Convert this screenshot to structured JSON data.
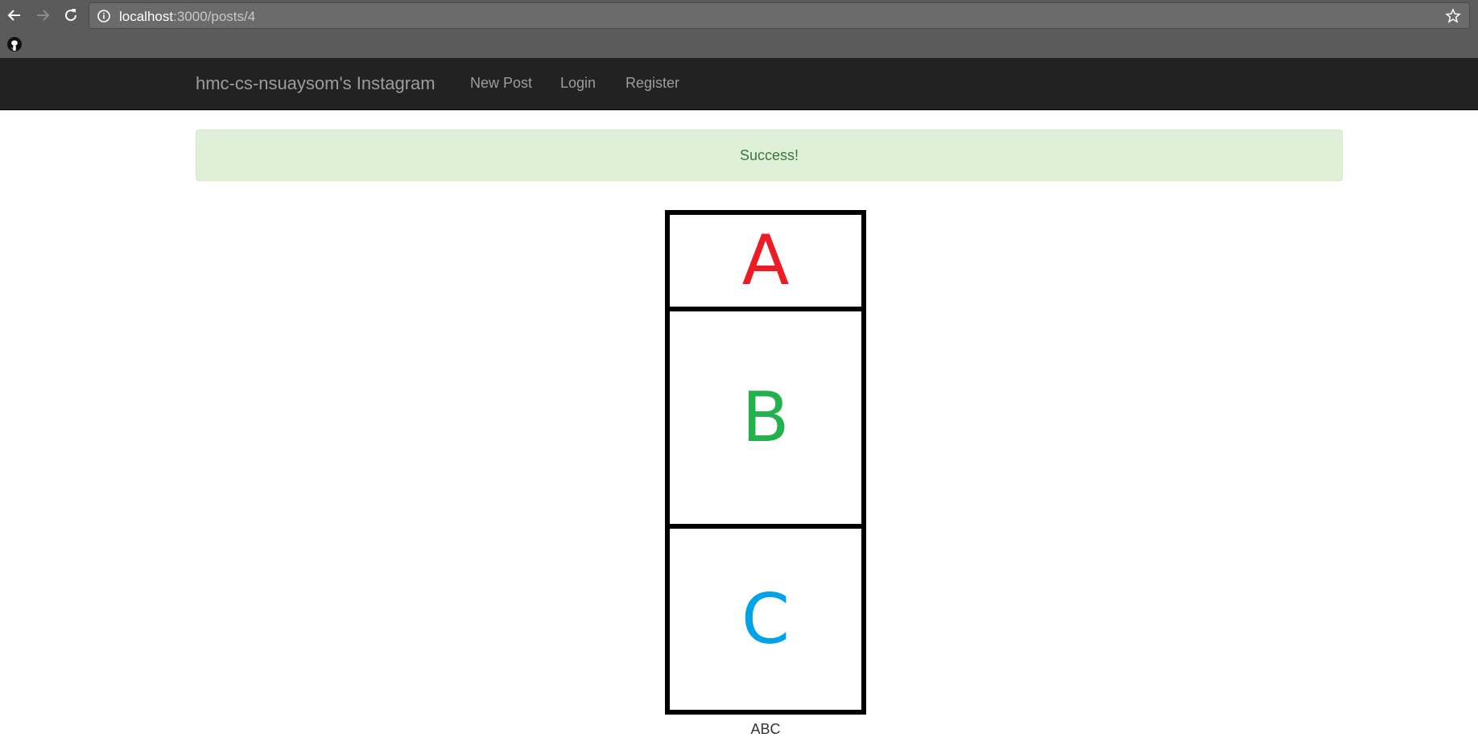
{
  "browser": {
    "url_host": "localhost",
    "url_path": ":3000/posts/4",
    "icons": {
      "back": "arrow-left-icon",
      "forward": "arrow-right-icon",
      "reload": "reload-icon",
      "info": "info-icon",
      "bookmark": "star-icon",
      "bookmark_bar_item": "github-icon"
    }
  },
  "navbar": {
    "brand": "hmc-cs-nsuaysom's Instagram",
    "links": [
      "New Post",
      "Login",
      "Register"
    ]
  },
  "alert": {
    "message": "Success!",
    "color": "#3c763d",
    "background": "#dff0d8"
  },
  "post": {
    "image_letters": [
      "A",
      "B",
      "C"
    ],
    "letter_colors": [
      "#ec1c24",
      "#22b14c",
      "#00a2e8"
    ],
    "caption": "ABC"
  }
}
